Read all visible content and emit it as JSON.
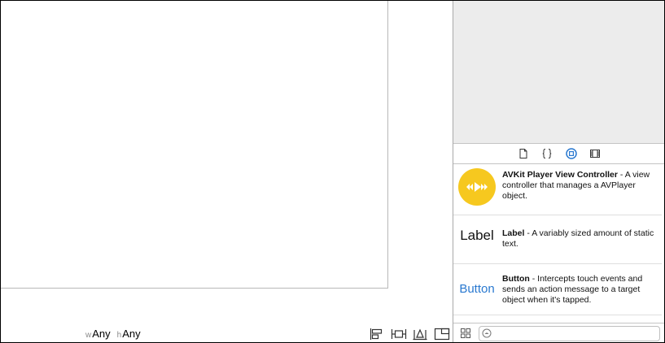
{
  "size_class": {
    "width_prefix": "w",
    "width_value": "Any",
    "height_prefix": "h",
    "height_value": "Any"
  },
  "layout_tools": [
    {
      "icon": "align-icon"
    },
    {
      "icon": "pin-icon"
    },
    {
      "icon": "resolve-issues-icon"
    },
    {
      "icon": "resizing-behavior-icon"
    }
  ],
  "library_tabs": [
    {
      "icon": "file-template-icon"
    },
    {
      "icon": "code-snippet-icon"
    },
    {
      "icon": "object-library-icon",
      "selected": true
    },
    {
      "icon": "media-library-icon"
    }
  ],
  "object_library": {
    "items": [
      {
        "icon": "avkit-player-icon",
        "name": "AVKit Player View Controller",
        "separator": " - ",
        "description": "A view controller that manages a AVPlayer object."
      },
      {
        "icon_text": "Label",
        "name": "Label",
        "separator": " - ",
        "description": "A variably sized amount of static text."
      },
      {
        "icon_text": "Button",
        "name": "Button",
        "separator": " - ",
        "description": "Intercepts touch events and sends an action message to a target object when it's tapped."
      }
    ]
  },
  "filter": {
    "value": "",
    "placeholder": ""
  },
  "colors": {
    "accent": "#2a79d0",
    "avkit_icon": "#f6c81f",
    "inspector_background": "#ececec"
  }
}
